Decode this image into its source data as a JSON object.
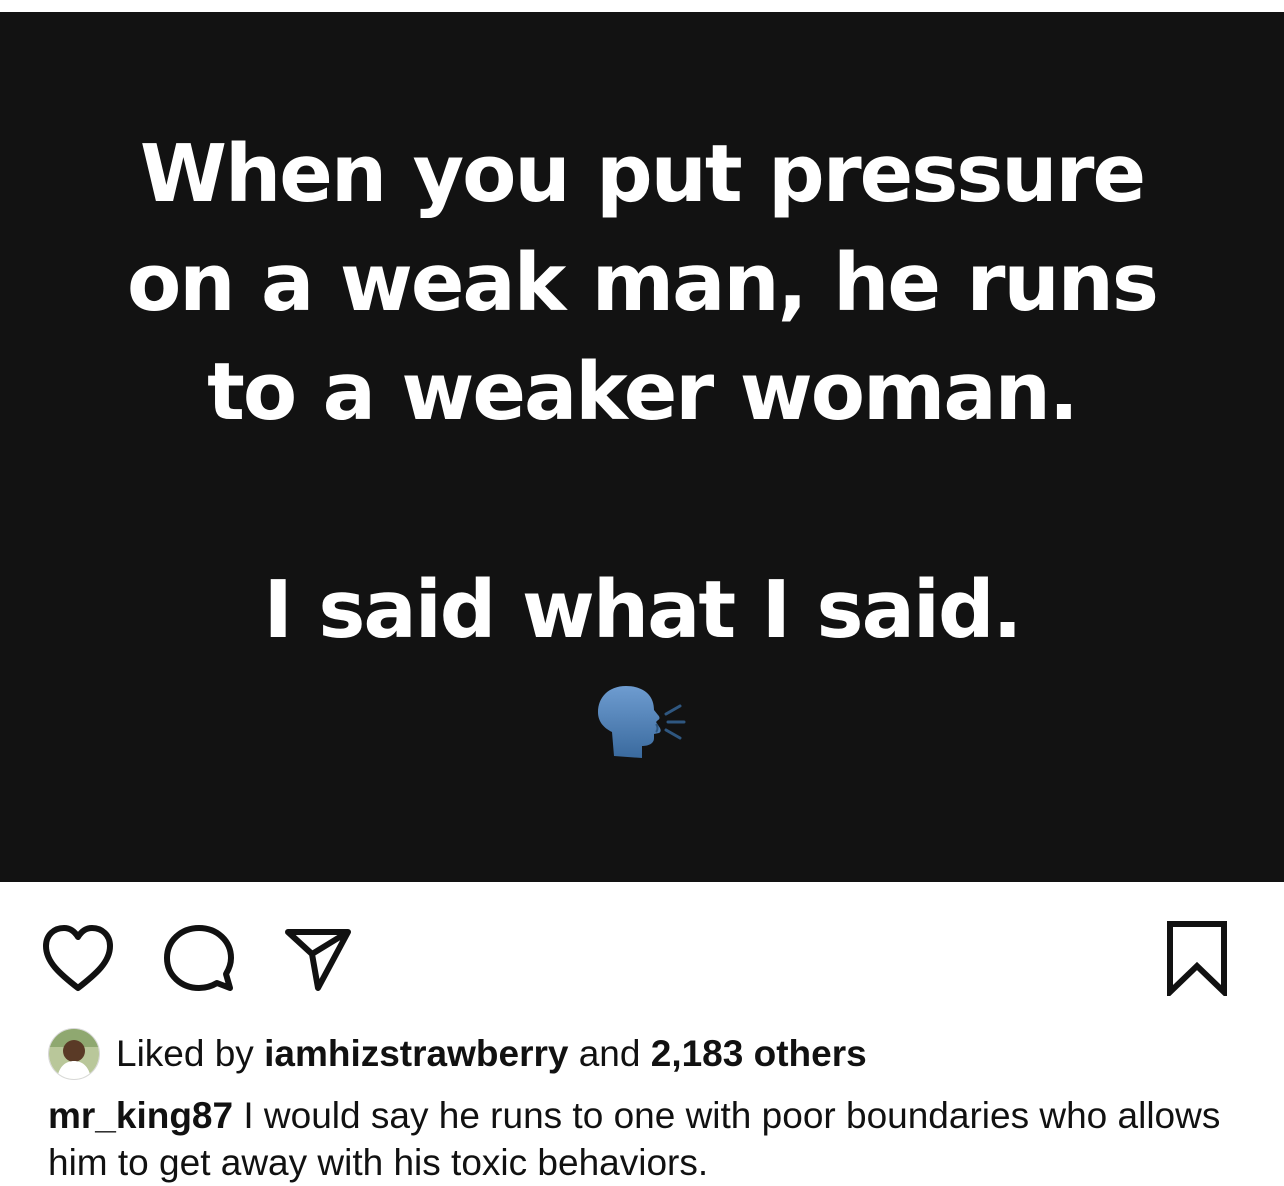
{
  "post": {
    "quote_lines": [
      "When you put pressure",
      "on a weak man, he runs",
      "to a weaker woman.",
      "I said what I said."
    ],
    "emoji": "speaking-head-icon"
  },
  "actions": {
    "icons": [
      "heart-icon",
      "comment-icon",
      "share-icon",
      "bookmark-icon"
    ]
  },
  "likes": {
    "prefix": "Liked by",
    "user": "iamhizstrawberry",
    "middle": "and",
    "count": "2,183 others"
  },
  "caption": {
    "username": "mr_king87",
    "text": "I would say he runs to one with poor boundaries who allows him to get away with his toxic behaviors."
  },
  "colors": {
    "image_background": "#121212",
    "text_primary": "#111111",
    "emoji_blue": "#4a7bb0"
  }
}
